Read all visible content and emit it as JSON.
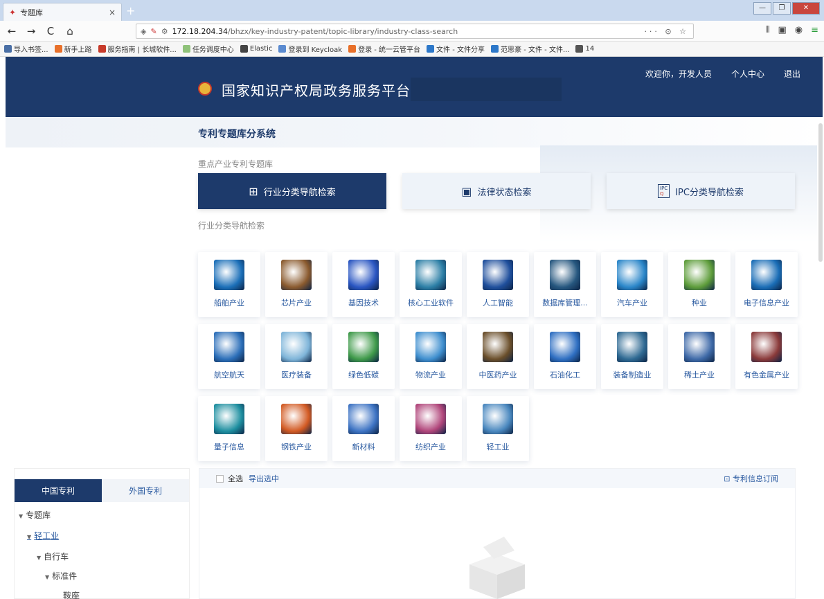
{
  "browser": {
    "tab_title": "专题库",
    "tab_close": "×",
    "new_tab": "+",
    "url_host": "172.18.204.34",
    "url_path": "/bhzx/key-industry-patent/topic-library/industry-class-search",
    "url_actions": "··· ⊙ ☆",
    "window_buttons": [
      "—",
      "❐",
      "✕"
    ],
    "nav_back": "←",
    "nav_forward": "→",
    "nav_reload": "C",
    "nav_home": "⌂",
    "bookmarks": [
      {
        "label": "导入书签...",
        "color": "#4a6fa5"
      },
      {
        "label": "新手上路",
        "color": "#e8702a"
      },
      {
        "label": "服务指南 | 长城软件...",
        "color": "#c73b2b"
      },
      {
        "label": "任务调度中心",
        "color": "#8fc27a"
      },
      {
        "label": "Elastic",
        "color": "#444444"
      },
      {
        "label": "登录到 Keycloak",
        "color": "#5b8bd0"
      },
      {
        "label": "登录 - 统一云管平台",
        "color": "#e8702a"
      },
      {
        "label": "文件 - 文件分享",
        "color": "#2d78c9"
      },
      {
        "label": "范思豪 - 文件 - 文件...",
        "color": "#2d78c9"
      },
      {
        "label": "14",
        "color": "#555555"
      }
    ]
  },
  "header": {
    "title": "国家知识产权局政务服务平台",
    "welcome": "欢迎你，开发人员",
    "profile": "个人中心",
    "logout": "退出"
  },
  "page": {
    "system_title": "专利专题库分系统",
    "section_label": "重点产业专利专题库",
    "search_tabs": [
      {
        "label": "行业分类导航检索",
        "icon": "grid-search-icon"
      },
      {
        "label": "法律状态检索",
        "icon": "law-search-icon"
      },
      {
        "label": "IPC分类导航检索",
        "icon": "ipc-search-icon"
      }
    ],
    "ipc_icon_top": "IPC",
    "ipc_icon_bottom": "Q",
    "nav_section_label": "行业分类导航检索"
  },
  "categories": [
    {
      "label": "船舶产业",
      "color": "#1b6fb8"
    },
    {
      "label": "芯片产业",
      "color": "#8a5a2e"
    },
    {
      "label": "基因技术",
      "color": "#2a56c2"
    },
    {
      "label": "核心工业软件",
      "color": "#2c7fa6"
    },
    {
      "label": "人工智能",
      "color": "#1f4f9c"
    },
    {
      "label": "数据库管理...",
      "color": "#26577f"
    },
    {
      "label": "汽车产业",
      "color": "#2a86c9"
    },
    {
      "label": "种业",
      "color": "#5d9c3a"
    },
    {
      "label": "电子信息产业",
      "color": "#1a6db6"
    },
    {
      "label": "航空航天",
      "color": "#2c6fb9"
    },
    {
      "label": "医疗装备",
      "color": "#7fb5d9"
    },
    {
      "label": "绿色低碳",
      "color": "#3f9a4a"
    },
    {
      "label": "物流产业",
      "color": "#3f8fcf"
    },
    {
      "label": "中医药产业",
      "color": "#6a4e2a"
    },
    {
      "label": "石油化工",
      "color": "#2f6fc2"
    },
    {
      "label": "装备制造业",
      "color": "#2f6a93"
    },
    {
      "label": "稀土产业",
      "color": "#3f6aa8"
    },
    {
      "label": "有色金属产业",
      "color": "#8a3a3a"
    },
    {
      "label": "量子信息",
      "color": "#1e8fa0"
    },
    {
      "label": "钢铁产业",
      "color": "#d25a23"
    },
    {
      "label": "新材料",
      "color": "#3e74c4"
    },
    {
      "label": "纺织产业",
      "color": "#b0457a"
    },
    {
      "label": "轻工业",
      "color": "#4a88bf"
    }
  ],
  "left_panel": {
    "tabs": [
      "中国专利",
      "外国专利"
    ],
    "tree": [
      "专题库",
      "轻工业",
      "自行车",
      "标准件",
      "鞍座"
    ]
  },
  "results": {
    "select_all": "全选",
    "export": "导出选中",
    "subscribe": "专利信息订阅",
    "subscribe_icon": "⊡"
  }
}
